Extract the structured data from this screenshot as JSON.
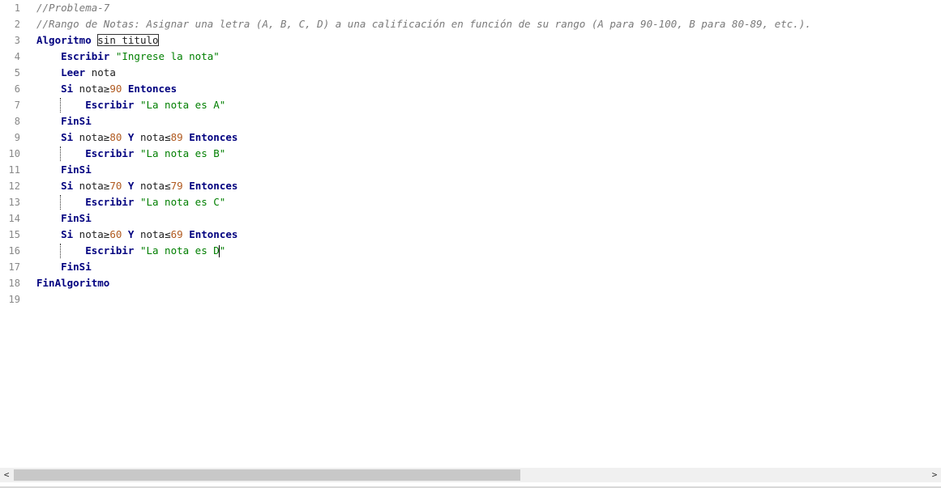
{
  "editor": {
    "lines": [
      {
        "n": "1",
        "segments": [
          {
            "t": "//Problema-7",
            "c": "comment"
          }
        ]
      },
      {
        "n": "2",
        "segments": [
          {
            "t": "//Rango de Notas: Asignar una letra (A, B, C, D) a una calificación en función de su rango (A para 90-100, B para 80-89, etc.).",
            "c": "comment"
          }
        ]
      },
      {
        "n": "3",
        "segments": [
          {
            "t": "Algoritmo",
            "c": "kw"
          },
          {
            "t": " ",
            "c": "id"
          },
          {
            "t": "sin_titulo",
            "c": "id boxed"
          }
        ]
      },
      {
        "n": "4",
        "segments": [
          {
            "t": "    Escribir",
            "c": "kw"
          },
          {
            "t": " ",
            "c": "id"
          },
          {
            "t": "\"Ingrese la nota\"",
            "c": "str"
          }
        ]
      },
      {
        "n": "5",
        "segments": [
          {
            "t": "    Leer",
            "c": "kw"
          },
          {
            "t": " nota",
            "c": "id"
          }
        ]
      },
      {
        "n": "6",
        "segments": [
          {
            "t": "    Si",
            "c": "kw"
          },
          {
            "t": " nota≥",
            "c": "id"
          },
          {
            "t": "90",
            "c": "num"
          },
          {
            "t": " ",
            "c": "id"
          },
          {
            "t": "Entonces",
            "c": "kw"
          }
        ]
      },
      {
        "n": "7",
        "segments": [
          {
            "t": "        Escribir",
            "c": "kw"
          },
          {
            "t": " ",
            "c": "id"
          },
          {
            "t": "\"La nota es A\"",
            "c": "str"
          }
        ]
      },
      {
        "n": "8",
        "segments": [
          {
            "t": "    FinSi",
            "c": "kw"
          }
        ]
      },
      {
        "n": "9",
        "segments": [
          {
            "t": "    Si",
            "c": "kw"
          },
          {
            "t": " nota≥",
            "c": "id"
          },
          {
            "t": "80",
            "c": "num"
          },
          {
            "t": " ",
            "c": "id"
          },
          {
            "t": "Y",
            "c": "kw"
          },
          {
            "t": " nota≤",
            "c": "id"
          },
          {
            "t": "89",
            "c": "num"
          },
          {
            "t": " ",
            "c": "id"
          },
          {
            "t": "Entonces",
            "c": "kw"
          }
        ]
      },
      {
        "n": "10",
        "segments": [
          {
            "t": "        Escribir",
            "c": "kw"
          },
          {
            "t": " ",
            "c": "id"
          },
          {
            "t": "\"La nota es B\"",
            "c": "str"
          }
        ]
      },
      {
        "n": "11",
        "segments": [
          {
            "t": "    FinSi",
            "c": "kw"
          }
        ]
      },
      {
        "n": "12",
        "segments": [
          {
            "t": "    Si",
            "c": "kw"
          },
          {
            "t": " nota≥",
            "c": "id"
          },
          {
            "t": "70",
            "c": "num"
          },
          {
            "t": " ",
            "c": "id"
          },
          {
            "t": "Y",
            "c": "kw"
          },
          {
            "t": " nota≤",
            "c": "id"
          },
          {
            "t": "79",
            "c": "num"
          },
          {
            "t": " ",
            "c": "id"
          },
          {
            "t": "Entonces",
            "c": "kw"
          }
        ]
      },
      {
        "n": "13",
        "segments": [
          {
            "t": "        Escribir",
            "c": "kw"
          },
          {
            "t": " ",
            "c": "id"
          },
          {
            "t": "\"La nota es C\"",
            "c": "str"
          }
        ]
      },
      {
        "n": "14",
        "segments": [
          {
            "t": "    FinSi",
            "c": "kw"
          }
        ]
      },
      {
        "n": "15",
        "segments": [
          {
            "t": "    Si",
            "c": "kw"
          },
          {
            "t": " nota≥",
            "c": "id"
          },
          {
            "t": "60",
            "c": "num"
          },
          {
            "t": " ",
            "c": "id"
          },
          {
            "t": "Y",
            "c": "kw"
          },
          {
            "t": " nota≤",
            "c": "id"
          },
          {
            "t": "69",
            "c": "num"
          },
          {
            "t": " ",
            "c": "id"
          },
          {
            "t": "Entonces",
            "c": "kw"
          }
        ]
      },
      {
        "n": "16",
        "segments": [
          {
            "t": "        Escribir",
            "c": "kw"
          },
          {
            "t": " ",
            "c": "id"
          },
          {
            "t": "\"La nota es D",
            "c": "str"
          },
          {
            "t": "",
            "c": "caret"
          },
          {
            "t": "\"",
            "c": "str"
          }
        ]
      },
      {
        "n": "17",
        "segments": [
          {
            "t": "    FinSi",
            "c": "kw"
          }
        ]
      },
      {
        "n": "18",
        "segments": [
          {
            "t": "FinAlgoritmo",
            "c": "kw"
          }
        ]
      },
      {
        "n": "19",
        "segments": []
      }
    ]
  },
  "scrollbar": {
    "left_arrow": "<",
    "right_arrow": ">",
    "left_icon": "chevron-left-icon",
    "right_icon": "chevron-right-icon"
  },
  "colors": {
    "keyword": "#00007f",
    "string": "#007f00",
    "number": "#b05a20",
    "comment": "#7a7a7a",
    "line_number": "#888888"
  }
}
